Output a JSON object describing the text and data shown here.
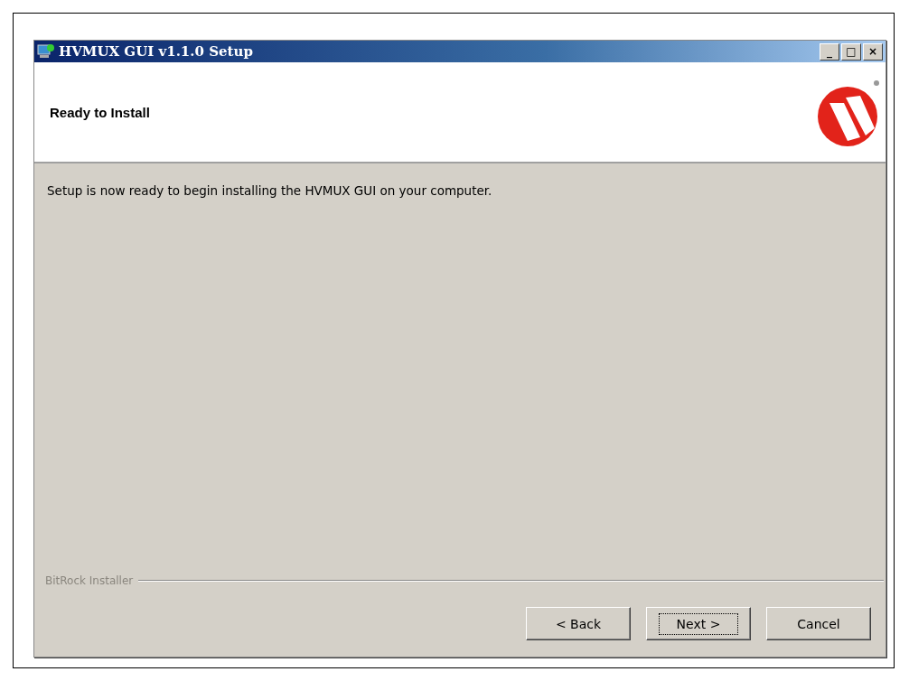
{
  "window": {
    "title": "HVMUX GUI v1.1.0 Setup",
    "controls": [
      "_",
      "□",
      "×"
    ]
  },
  "header": {
    "title": "Ready to Install"
  },
  "body": {
    "message": "Setup is now ready to begin installing the HVMUX GUI on your computer."
  },
  "footer": {
    "brand": "BitRock Installer"
  },
  "buttons": [
    {
      "label": "< Back",
      "focused": false
    },
    {
      "label": "Next >",
      "focused": true
    },
    {
      "label": "Cancel",
      "focused": false
    }
  ]
}
